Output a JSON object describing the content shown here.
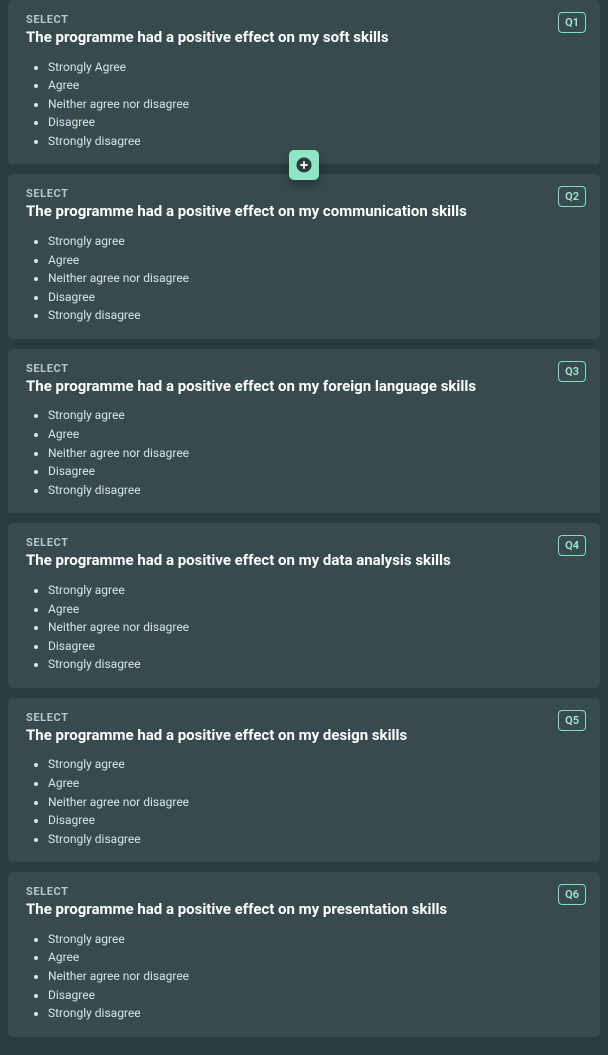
{
  "questions": [
    {
      "type_label": "SELECT",
      "badge": "Q1",
      "title": "The programme had a positive effect on my soft skills",
      "options": [
        "Strongly Agree",
        "Agree",
        "Neither agree nor disagree",
        "Disagree",
        "Strongly disagree"
      ],
      "show_add": true
    },
    {
      "type_label": "SELECT",
      "badge": "Q2",
      "title": "The programme had a positive effect on my communication skills",
      "options": [
        "Strongly agree",
        "Agree",
        "Neither agree nor disagree",
        "Disagree",
        "Strongly disagree"
      ],
      "show_add": false
    },
    {
      "type_label": "SELECT",
      "badge": "Q3",
      "title": "The programme had a positive effect on my foreign language skills",
      "options": [
        "Strongly agree",
        "Agree",
        "Neither agree nor disagree",
        "Disagree",
        "Strongly disagree"
      ],
      "show_add": false
    },
    {
      "type_label": "SELECT",
      "badge": "Q4",
      "title": "The programme had a positive effect on my data analysis skills",
      "options": [
        "Strongly agree",
        "Agree",
        "Neither agree nor disagree",
        "Disagree",
        "Strongly disagree"
      ],
      "show_add": false
    },
    {
      "type_label": "SELECT",
      "badge": "Q5",
      "title": "The programme had a positive effect on my design skills",
      "options": [
        "Strongly agree",
        "Agree",
        "Neither agree nor disagree",
        "Disagree",
        "Strongly disagree"
      ],
      "show_add": false
    },
    {
      "type_label": "SELECT",
      "badge": "Q6",
      "title": "The programme had a positive effect on my presentation skills",
      "options": [
        "Strongly agree",
        "Agree",
        "Neither agree nor disagree",
        "Disagree",
        "Strongly disagree"
      ],
      "show_add": false
    }
  ]
}
